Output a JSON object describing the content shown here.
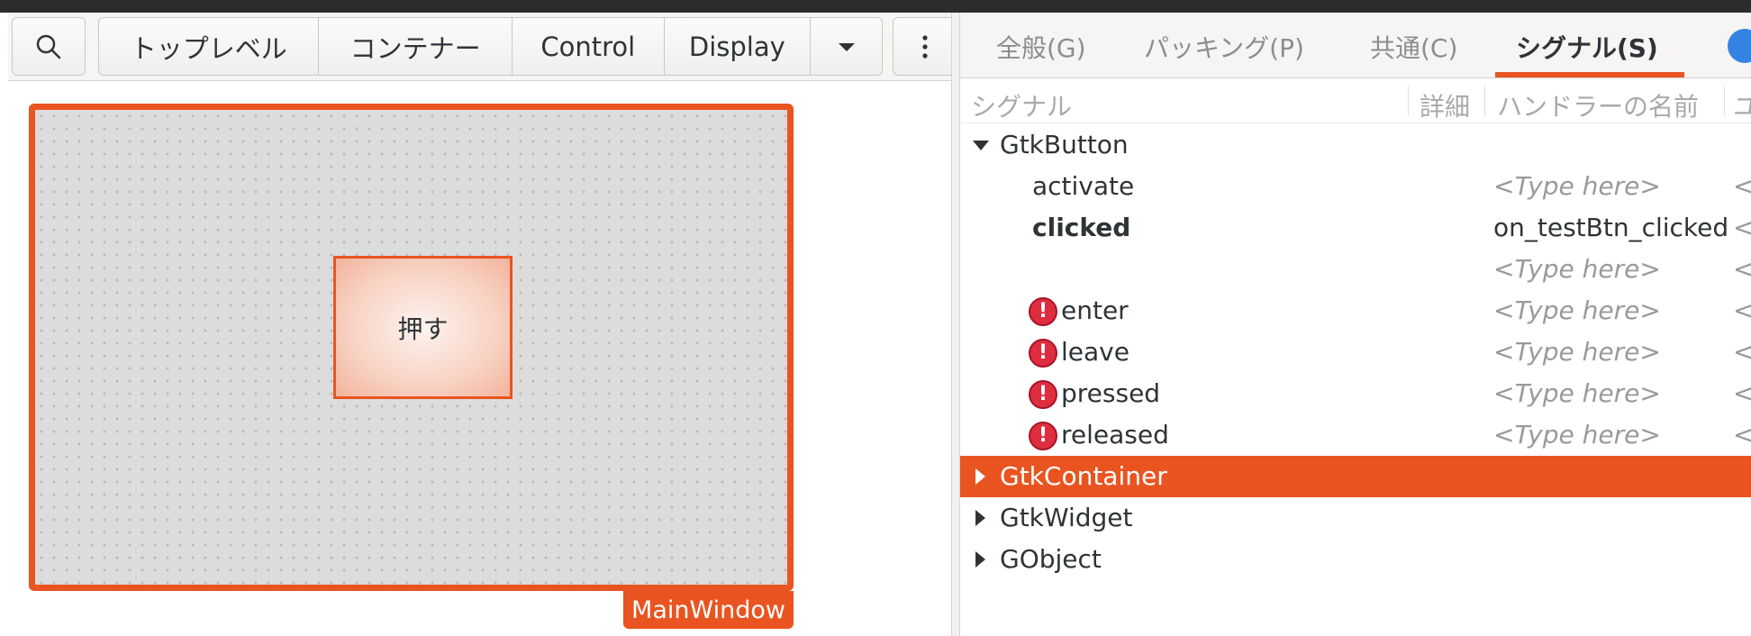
{
  "palette": {
    "search_icon": "search-icon",
    "groups": [
      "トップレベル",
      "コンテナー",
      "Control",
      "Display"
    ],
    "more_menu_icon": "vertical-ellipsis-icon",
    "dropdown_icon": "chevron-down-icon"
  },
  "canvas": {
    "button_label": "押す",
    "window_label": "MainWindow"
  },
  "inspector": {
    "tabs": [
      "全般(G)",
      "パッキング(P)",
      "共通(C)",
      "シグナル(S)"
    ],
    "active_tab": "シグナル(S)",
    "columns": {
      "signal": "シグナル",
      "detail": "詳細",
      "handler": "ハンドラーの名前",
      "extra": "ユ"
    },
    "tree": {
      "button_class": "GtkButton",
      "signals": [
        {
          "name": "activate",
          "handler": "<Type here>",
          "bold": false,
          "warning": false
        },
        {
          "name": "clicked",
          "handler": "on_testBtn_clicked",
          "bold": true,
          "warning": false
        },
        {
          "name": "",
          "handler": "<Type here>",
          "bold": false,
          "warning": false
        },
        {
          "name": "enter",
          "handler": "<Type here>",
          "bold": false,
          "warning": true
        },
        {
          "name": "leave",
          "handler": "<Type here>",
          "bold": false,
          "warning": true
        },
        {
          "name": "pressed",
          "handler": "<Type here>",
          "bold": false,
          "warning": true
        },
        {
          "name": "released",
          "handler": "<Type here>",
          "bold": false,
          "warning": true
        }
      ],
      "collapsed_classes": [
        "GtkContainer",
        "GtkWidget",
        "GObject"
      ],
      "extra_glyph": "<",
      "warning_glyph": "!"
    }
  },
  "colors": {
    "accent": "#e95420",
    "warning": "#df2d40"
  }
}
